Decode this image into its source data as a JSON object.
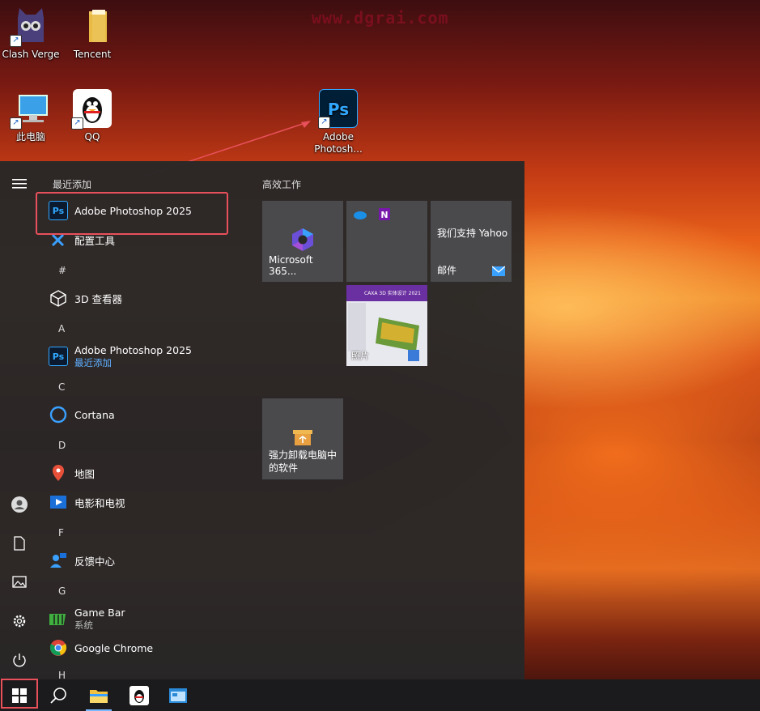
{
  "watermark": "www.dgrai.com",
  "desktop": {
    "icons": [
      {
        "label": "Clash Verge"
      },
      {
        "label": "Tencent"
      },
      {
        "label": "此电脑"
      },
      {
        "label": "QQ"
      },
      {
        "label": "Adobe Photosh..."
      }
    ]
  },
  "start_menu": {
    "recent_header": "最近添加",
    "recent_apps": [
      {
        "label": "Adobe Photoshop 2025",
        "icon": "photoshop-icon"
      },
      {
        "label": "配置工具",
        "icon": "wrench-screwdriver-icon"
      }
    ],
    "groups": [
      {
        "letter": "#",
        "apps": [
          {
            "label": "3D 查看器",
            "icon": "cube-icon"
          }
        ]
      },
      {
        "letter": "A",
        "apps": [
          {
            "label": "Adobe Photoshop 2025",
            "sub": "最近添加",
            "icon": "photoshop-icon"
          }
        ]
      },
      {
        "letter": "C",
        "apps": [
          {
            "label": "Cortana",
            "icon": "cortana-ring-icon"
          }
        ]
      },
      {
        "letter": "D",
        "apps": [
          {
            "label": "地图",
            "icon": "map-pin-icon"
          },
          {
            "label": "电影和电视",
            "icon": "film-play-icon"
          }
        ]
      },
      {
        "letter": "F",
        "apps": [
          {
            "label": "反馈中心",
            "icon": "feedback-person-icon"
          }
        ]
      },
      {
        "letter": "G",
        "apps": [
          {
            "label": "Game Bar",
            "sub": "系统",
            "icon": "xbox-game-bar-icon"
          },
          {
            "label": "Google Chrome",
            "icon": "chrome-icon"
          }
        ]
      },
      {
        "letter": "H",
        "apps": []
      }
    ],
    "tiles_header": "高效工作",
    "tiles": [
      {
        "label": "Microsoft 365...",
        "icon": "m365-icon"
      },
      {
        "label": "",
        "icon": "onedrive-onenote-icon"
      },
      {
        "label": "我们支持 Yahoo",
        "label2": "邮件",
        "icon": "mail-icon"
      },
      {
        "label": "照片",
        "icon": "photos-icon"
      },
      {
        "label": "强力卸载电脑中的软件",
        "icon": "uninstall-box-icon"
      }
    ],
    "tile_preview_title": "CAXA 3D 实体设计 2021"
  },
  "colors": {
    "highlight": "#e8505b",
    "accent_link": "#5fb0ff",
    "menu_bg": "#262628",
    "taskbar_bg": "#1b1b1d"
  }
}
